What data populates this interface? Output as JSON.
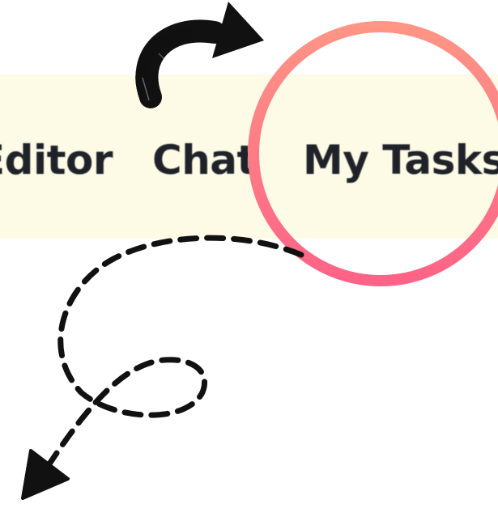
{
  "nav": {
    "items": [
      {
        "label": "Editor"
      },
      {
        "label": "Chat"
      },
      {
        "label": "My Tasks"
      }
    ]
  },
  "annotation": {
    "highlight_color": "#ff6f86",
    "ink_color": "#111111",
    "bar_color": "#fdfae6"
  }
}
